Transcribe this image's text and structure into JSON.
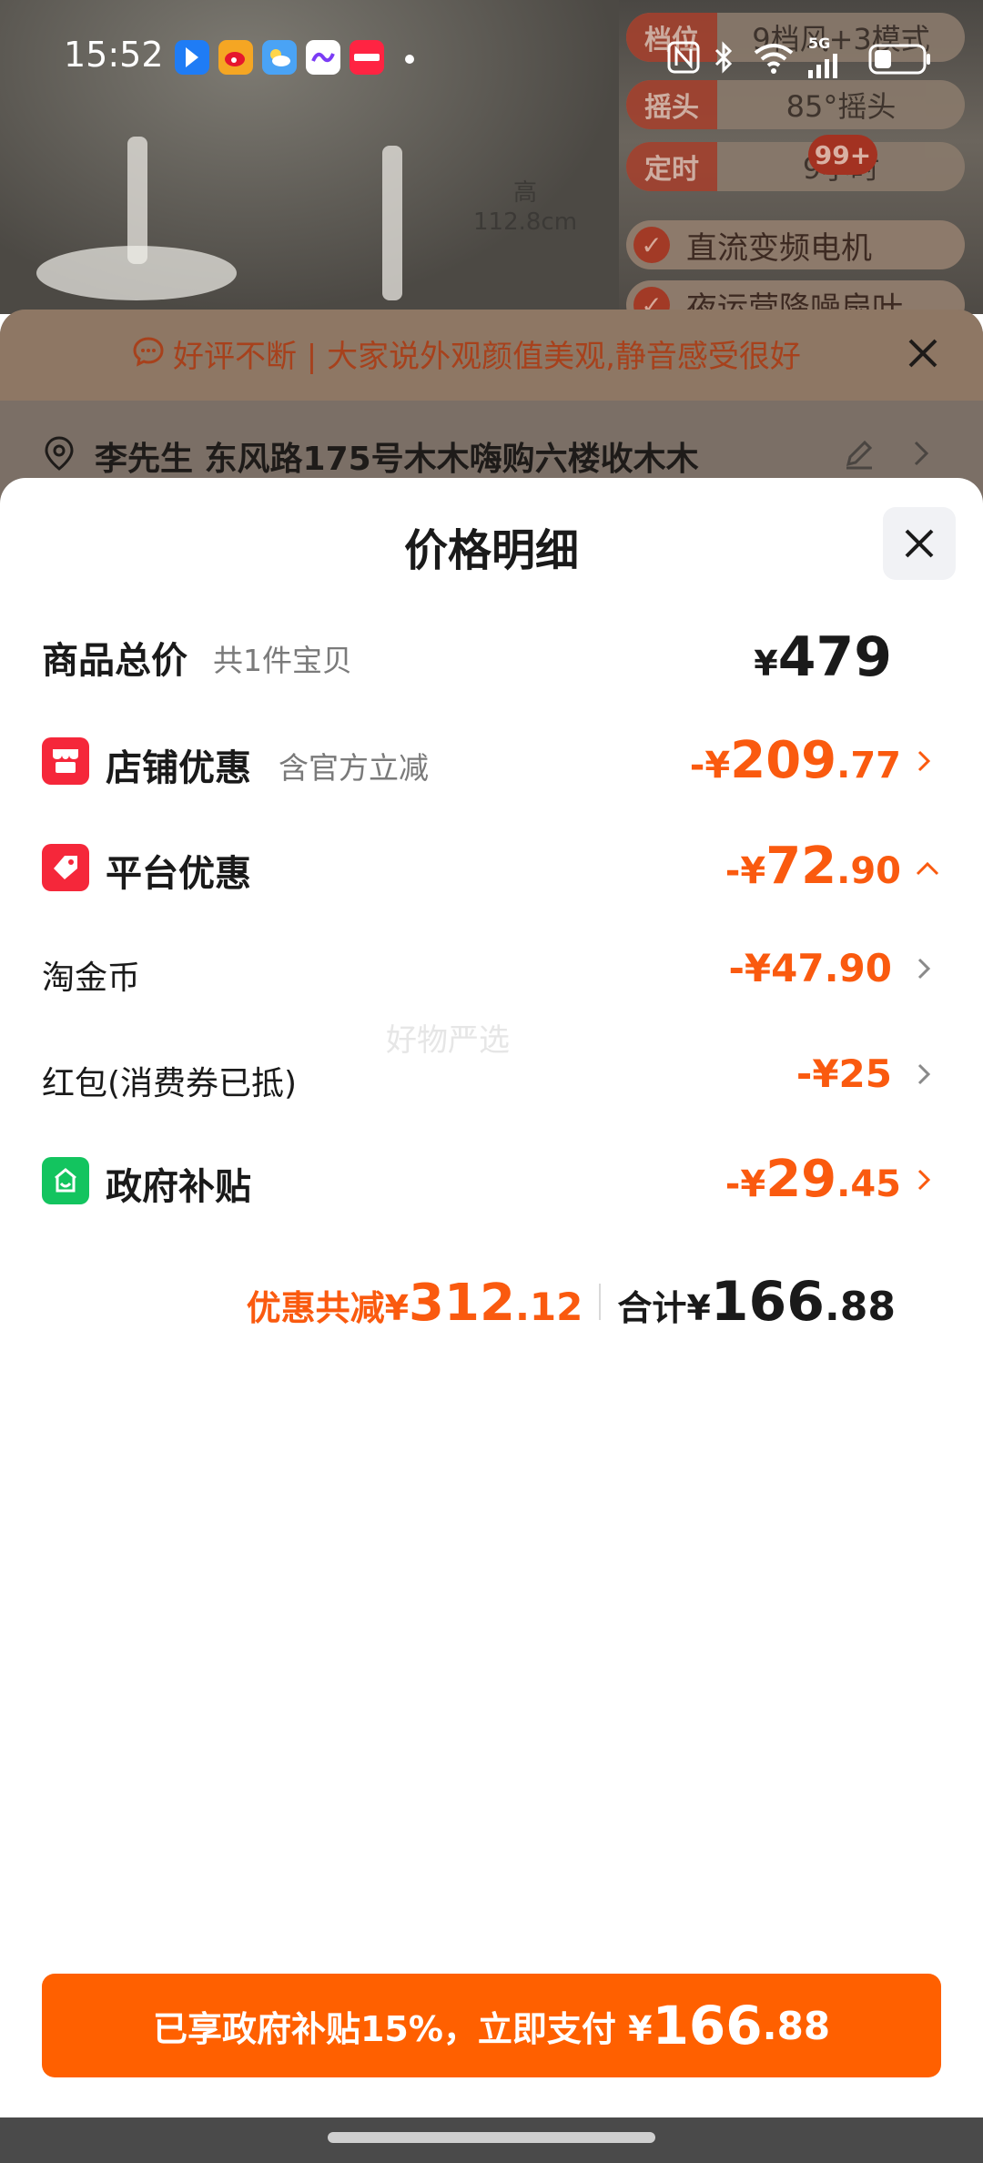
{
  "status_bar": {
    "time": "15:52",
    "network": "5G"
  },
  "background_page": {
    "product_height_label_line1": "高",
    "product_height_label_line2": "112.8cm",
    "specs": [
      {
        "key": "档位",
        "value": "9档风+3模式"
      },
      {
        "key": "摇头",
        "value": "85°摇头"
      },
      {
        "key": "定时",
        "value": "9小时"
      }
    ],
    "features": [
      "直流变频电机",
      "夜运营降噪扇叶"
    ],
    "badge": "99+",
    "review_banner": "好评不断 | 大家说外观颜值美观,静音感受很好",
    "address": "李先生 东风路175号木木嗨购六楼收木木"
  },
  "sheet": {
    "title": "价格明细",
    "goods_total": {
      "label": "商品总价",
      "sub": "共1件宝贝",
      "currency": "¥",
      "amount": "479"
    },
    "store_discount": {
      "label": "店铺优惠",
      "sub": "含官方立减",
      "prefix": "-¥",
      "amount_int": "209",
      "amount_dec": ".77"
    },
    "platform_discount": {
      "label": "平台优惠",
      "prefix": "-¥",
      "amount_int": "72",
      "amount_dec": ".90"
    },
    "taojinbi": {
      "label": "淘金币",
      "amount": "-¥47.90"
    },
    "red_packet": {
      "label": "红包(消费券已抵)",
      "amount": "-¥25"
    },
    "gov_subsidy": {
      "label": "政府补贴",
      "prefix": "-¥",
      "amount_int": "29",
      "amount_dec": ".45"
    },
    "watermark": "好物严选",
    "summary": {
      "discount_label": "优惠共减¥",
      "discount_int": "312",
      "discount_dec": ".12",
      "total_label": "合计¥",
      "total_int": "166",
      "total_dec": ".88"
    },
    "pay_button": {
      "text": "已享政府补贴15%，立即支付 ¥",
      "amount_int": "166",
      "amount_dec": ".88"
    }
  },
  "colors": {
    "accent_orange": "#fa5a0f",
    "button_orange": "#ff6000",
    "store_icon_red": "#f5273a",
    "platform_icon_red": "#f5273a",
    "gov_icon_green": "#13c45f"
  },
  "icons": [
    "location-icon",
    "edit-icon",
    "close-icon",
    "store-icon",
    "tag-icon",
    "subsidy-icon",
    "chevron-right-icon",
    "chevron-up-icon",
    "comment-icon"
  ]
}
